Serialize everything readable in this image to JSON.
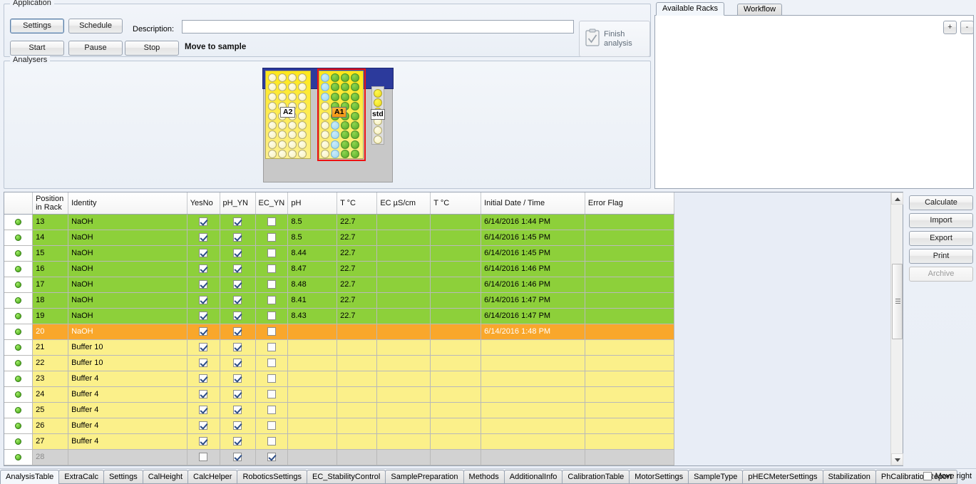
{
  "application": {
    "group_caption": "Application",
    "settings_label": "Settings",
    "schedule_label": "Schedule",
    "start_label": "Start",
    "pause_label": "Pause",
    "stop_label": "Stop",
    "description_label": "Description:",
    "description_value": "",
    "description_placeholder": "",
    "status_text": "Move to sample",
    "finish_line1": "Finish",
    "finish_line2": "analysis",
    "finish_icon": "clipboard-check-icon"
  },
  "analysers": {
    "group_caption": "Analysers",
    "rack_a2_label": "A2",
    "rack_a1_label": "A1",
    "rack_std_label": "std"
  },
  "right_panel": {
    "tabs": [
      {
        "label": "Available Racks",
        "active": true
      },
      {
        "label": "Workflow",
        "active": false
      }
    ],
    "plus_label": "+",
    "minus_label": "-"
  },
  "grid": {
    "columns": [
      {
        "key": "status",
        "label": ""
      },
      {
        "key": "position",
        "label_line1": "Position",
        "label_line2": "in Rack"
      },
      {
        "key": "identity",
        "label": "Identity"
      },
      {
        "key": "yesno",
        "label": "YesNo"
      },
      {
        "key": "ph_yn",
        "label": "pH_YN"
      },
      {
        "key": "ec_yn",
        "label": "EC_YN"
      },
      {
        "key": "ph",
        "label": "pH"
      },
      {
        "key": "t_c_1",
        "label": "T °C"
      },
      {
        "key": "ec",
        "label": "EC µS/cm"
      },
      {
        "key": "t_c_2",
        "label": "T °C"
      },
      {
        "key": "datetime",
        "label": "Initial Date / Time"
      },
      {
        "key": "errorflag",
        "label": "Error Flag"
      }
    ],
    "rows": [
      {
        "style": "green",
        "status": "ok",
        "position": "13",
        "identity": "NaOH",
        "yesno": true,
        "ph_yn": true,
        "ec_yn": false,
        "ph": "8.5",
        "t_c_1": "22.7",
        "ec": "",
        "t_c_2": "",
        "datetime": "6/14/2016 1:44 PM",
        "errorflag": ""
      },
      {
        "style": "green",
        "status": "ok",
        "position": "14",
        "identity": "NaOH",
        "yesno": true,
        "ph_yn": true,
        "ec_yn": false,
        "ph": "8.5",
        "t_c_1": "22.7",
        "ec": "",
        "t_c_2": "",
        "datetime": "6/14/2016 1:45 PM",
        "errorflag": ""
      },
      {
        "style": "green",
        "status": "ok",
        "position": "15",
        "identity": "NaOH",
        "yesno": true,
        "ph_yn": true,
        "ec_yn": false,
        "ph": "8.44",
        "t_c_1": "22.7",
        "ec": "",
        "t_c_2": "",
        "datetime": "6/14/2016 1:45 PM",
        "errorflag": ""
      },
      {
        "style": "green",
        "status": "ok",
        "position": "16",
        "identity": "NaOH",
        "yesno": true,
        "ph_yn": true,
        "ec_yn": false,
        "ph": "8.47",
        "t_c_1": "22.7",
        "ec": "",
        "t_c_2": "",
        "datetime": "6/14/2016 1:46 PM",
        "errorflag": ""
      },
      {
        "style": "green",
        "status": "ok",
        "position": "17",
        "identity": "NaOH",
        "yesno": true,
        "ph_yn": true,
        "ec_yn": false,
        "ph": "8.48",
        "t_c_1": "22.7",
        "ec": "",
        "t_c_2": "",
        "datetime": "6/14/2016 1:46 PM",
        "errorflag": ""
      },
      {
        "style": "green",
        "status": "ok",
        "position": "18",
        "identity": "NaOH",
        "yesno": true,
        "ph_yn": true,
        "ec_yn": false,
        "ph": "8.41",
        "t_c_1": "22.7",
        "ec": "",
        "t_c_2": "",
        "datetime": "6/14/2016 1:47 PM",
        "errorflag": ""
      },
      {
        "style": "green",
        "status": "ok",
        "position": "19",
        "identity": "NaOH",
        "yesno": true,
        "ph_yn": true,
        "ec_yn": false,
        "ph": "8.43",
        "t_c_1": "22.7",
        "ec": "",
        "t_c_2": "",
        "datetime": "6/14/2016 1:47 PM",
        "errorflag": ""
      },
      {
        "style": "orange",
        "status": "ok",
        "position": "20",
        "identity": "NaOH",
        "yesno": true,
        "ph_yn": true,
        "ec_yn": false,
        "ph": "",
        "t_c_1": "",
        "ec": "",
        "t_c_2": "",
        "datetime": "6/14/2016 1:48 PM",
        "errorflag": ""
      },
      {
        "style": "yellow",
        "status": "ok",
        "position": "21",
        "identity": "Buffer 10",
        "yesno": true,
        "ph_yn": true,
        "ec_yn": false,
        "ph": "",
        "t_c_1": "",
        "ec": "",
        "t_c_2": "",
        "datetime": "",
        "errorflag": ""
      },
      {
        "style": "yellow",
        "status": "ok",
        "position": "22",
        "identity": "Buffer 10",
        "yesno": true,
        "ph_yn": true,
        "ec_yn": false,
        "ph": "",
        "t_c_1": "",
        "ec": "",
        "t_c_2": "",
        "datetime": "",
        "errorflag": ""
      },
      {
        "style": "yellow",
        "status": "ok",
        "position": "23",
        "identity": "Buffer 4",
        "yesno": true,
        "ph_yn": true,
        "ec_yn": false,
        "ph": "",
        "t_c_1": "",
        "ec": "",
        "t_c_2": "",
        "datetime": "",
        "errorflag": ""
      },
      {
        "style": "yellow",
        "status": "ok",
        "position": "24",
        "identity": "Buffer 4",
        "yesno": true,
        "ph_yn": true,
        "ec_yn": false,
        "ph": "",
        "t_c_1": "",
        "ec": "",
        "t_c_2": "",
        "datetime": "",
        "errorflag": ""
      },
      {
        "style": "yellow",
        "status": "ok",
        "position": "25",
        "identity": "Buffer 4",
        "yesno": true,
        "ph_yn": true,
        "ec_yn": false,
        "ph": "",
        "t_c_1": "",
        "ec": "",
        "t_c_2": "",
        "datetime": "",
        "errorflag": ""
      },
      {
        "style": "yellow",
        "status": "ok",
        "position": "26",
        "identity": "Buffer 4",
        "yesno": true,
        "ph_yn": true,
        "ec_yn": false,
        "ph": "",
        "t_c_1": "",
        "ec": "",
        "t_c_2": "",
        "datetime": "",
        "errorflag": ""
      },
      {
        "style": "yellow",
        "status": "ok",
        "position": "27",
        "identity": "Buffer 4",
        "yesno": true,
        "ph_yn": true,
        "ec_yn": false,
        "ph": "",
        "t_c_1": "",
        "ec": "",
        "t_c_2": "",
        "datetime": "",
        "errorflag": ""
      },
      {
        "style": "gray",
        "status": "ok",
        "position": "28",
        "identity": "",
        "yesno": false,
        "ph_yn": true,
        "ec_yn": true,
        "ph": "",
        "t_c_1": "",
        "ec": "",
        "t_c_2": "",
        "datetime": "",
        "errorflag": ""
      }
    ]
  },
  "side_buttons": [
    {
      "label": "Calculate",
      "disabled": false
    },
    {
      "label": "Import",
      "disabled": false
    },
    {
      "label": "Export",
      "disabled": false
    },
    {
      "label": "Print",
      "disabled": false
    },
    {
      "label": "Archive",
      "disabled": true
    }
  ],
  "bottom_tabs": [
    {
      "label": "AnalysisTable",
      "active": true
    },
    {
      "label": "ExtraCalc",
      "active": false
    },
    {
      "label": "Settings",
      "active": false
    },
    {
      "label": "CalHeight",
      "active": false
    },
    {
      "label": "CalcHelper",
      "active": false
    },
    {
      "label": "RoboticsSettings",
      "active": false
    },
    {
      "label": "EC_StabilityControl",
      "active": false
    },
    {
      "label": "SamplePreparation",
      "active": false
    },
    {
      "label": "Methods",
      "active": false
    },
    {
      "label": "AdditionalInfo",
      "active": false
    },
    {
      "label": "CalibrationTable",
      "active": false
    },
    {
      "label": "MotorSettings",
      "active": false
    },
    {
      "label": "SampleType",
      "active": false
    },
    {
      "label": "pHECMeterSettings",
      "active": false
    },
    {
      "label": "Stabilization",
      "active": false
    },
    {
      "label": "PhCalibrationReport",
      "active": false
    }
  ],
  "move_right": {
    "label": "Move right",
    "checked": false
  },
  "rack_wells": {
    "a2": [
      [
        "empty",
        "empty",
        "empty",
        "empty"
      ],
      [
        "empty",
        "empty",
        "empty",
        "empty"
      ],
      [
        "empty",
        "empty",
        "empty",
        "empty"
      ],
      [
        "empty",
        "empty",
        "empty",
        "empty"
      ],
      [
        "empty",
        "empty",
        "empty",
        "empty"
      ],
      [
        "empty",
        "empty",
        "empty",
        "empty"
      ],
      [
        "empty",
        "empty",
        "empty",
        "empty"
      ],
      [
        "empty",
        "empty",
        "empty",
        "empty"
      ],
      [
        "empty",
        "empty",
        "empty",
        "empty"
      ]
    ],
    "a1": [
      [
        "blue",
        "green",
        "green",
        "green"
      ],
      [
        "blue",
        "green",
        "green",
        "green"
      ],
      [
        "blue",
        "green",
        "green",
        "green"
      ],
      [
        "empty",
        "green",
        "green",
        "green"
      ],
      [
        "empty",
        "green",
        "green",
        "green"
      ],
      [
        "empty",
        "blue",
        "green",
        "green"
      ],
      [
        "empty",
        "blue",
        "green",
        "green"
      ],
      [
        "empty",
        "blue",
        "green",
        "green"
      ],
      [
        "empty",
        "blue",
        "green",
        "green"
      ]
    ],
    "std": [
      "yellow",
      "yellow",
      "yellow",
      "empty",
      "empty",
      "empty"
    ]
  },
  "colors": {
    "row_green": "#8dd03a",
    "row_yellow": "#fbf08a",
    "row_orange": "#f9a72b",
    "row_gray": "#d2d2d2",
    "rack_header": "#2c3a9c",
    "rack_selection": "#ee1111",
    "well_green": "#6fbf33",
    "well_blue": "#a9dcf0",
    "well_yellow": "#f4e01c"
  }
}
